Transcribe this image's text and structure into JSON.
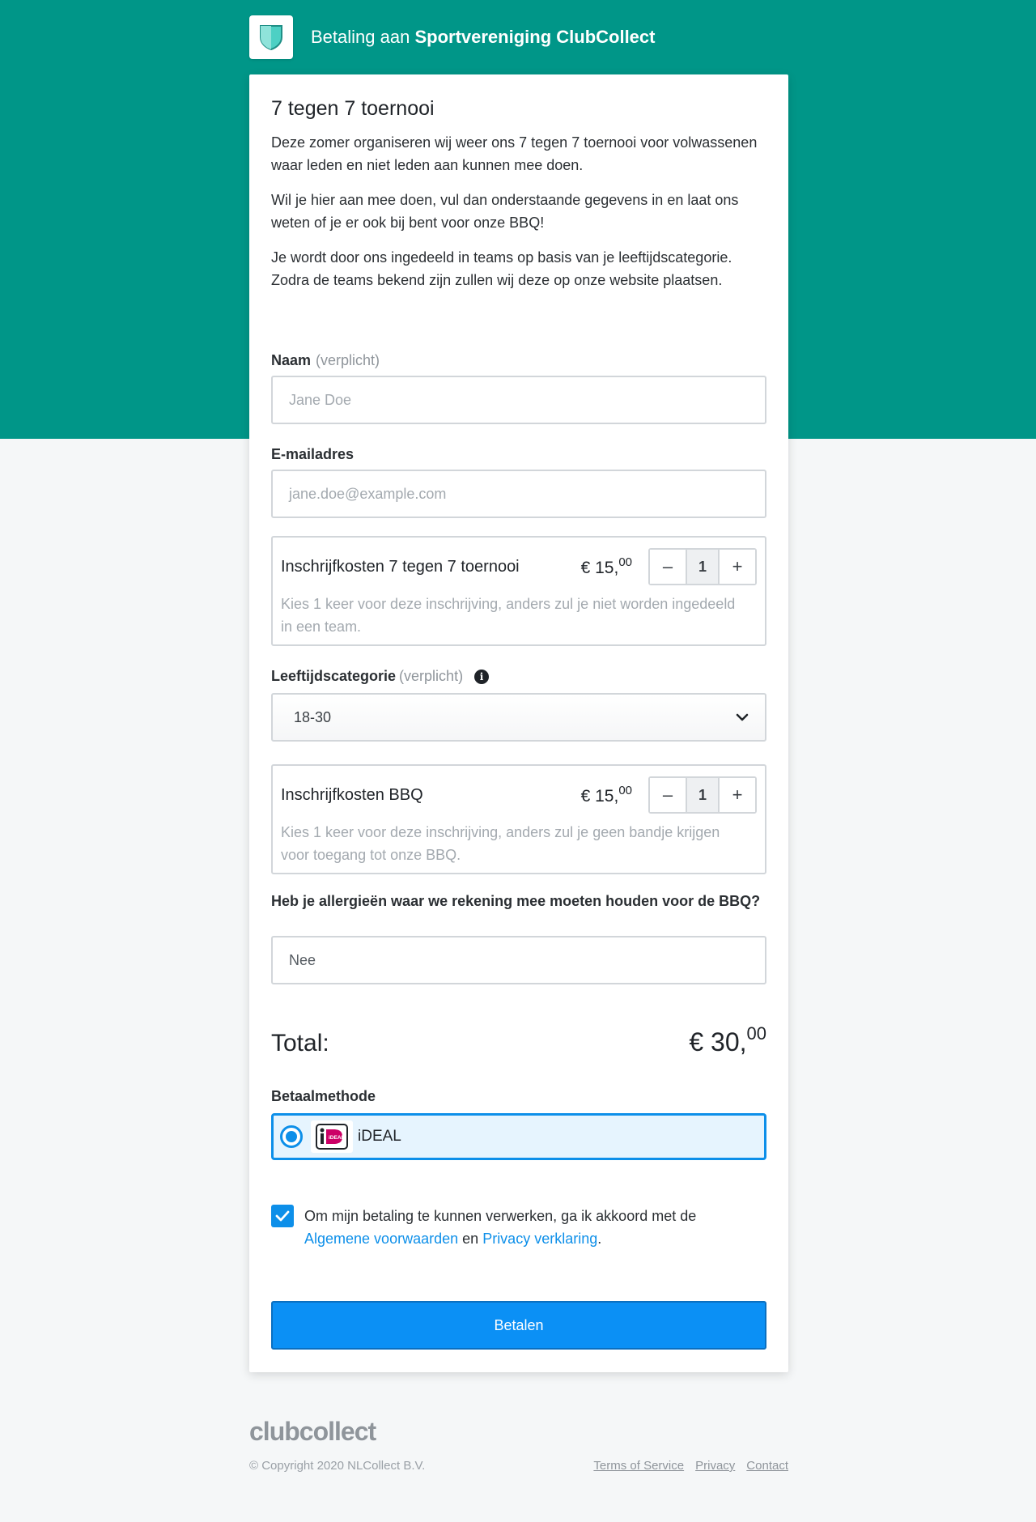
{
  "header": {
    "prefix": "Betaling aan",
    "club_name": "Sportvereniging ClubCollect"
  },
  "form": {
    "title": "7 tegen 7 toernooi",
    "description": [
      "Deze zomer organiseren wij weer ons 7 tegen 7 toernooi voor volwassenen waar leden en niet leden aan kunnen mee doen.",
      "Wil je hier aan mee doen, vul dan onderstaande gegevens in en laat ons weten of je er ook bij bent voor onze BBQ!",
      "Je wordt door ons ingedeeld in teams op basis van je leeftijdscategorie. Zodra de teams bekend zijn zullen wij deze op onze website plaatsen."
    ],
    "name_field": {
      "label": "Naam",
      "required_hint": "(verplicht)",
      "placeholder": "Jane Doe"
    },
    "email_field": {
      "label": "E-mailadres",
      "placeholder": "jane.doe@example.com"
    },
    "products": [
      {
        "name": "Inschrijfkosten 7 tegen 7 toernooi",
        "price_main": "€ 15,",
        "price_cents": "00",
        "quantity": "1",
        "minus": "–",
        "plus": "+",
        "description": "Kies 1 keer voor deze inschrijving, anders zul je niet worden ingedeeld in een team."
      },
      {
        "name": "Inschrijfkosten BBQ",
        "price_main": "€ 15,",
        "price_cents": "00",
        "quantity": "1",
        "minus": "–",
        "plus": "+",
        "description": "Kies 1 keer voor deze inschrijving, anders zul je geen bandje krijgen voor toegang tot onze BBQ."
      }
    ],
    "age_category": {
      "label": "Leeftijdscategorie",
      "required_hint": "(verplicht)",
      "info_icon": "i",
      "selected": "18-30"
    },
    "allergies": {
      "label": "Heb je allergieën waar we rekening mee moeten houden voor de BBQ?",
      "value": "Nee"
    },
    "total": {
      "label": "Total:",
      "value_main": "€ 30,",
      "value_cents": "00"
    },
    "payment": {
      "label": "Betaalmethode",
      "method": "iDEAL",
      "logo_text": "iDEAL",
      "selected": true
    },
    "consent": {
      "checked": true,
      "text_before": "Om mijn betaling te kunnen verwerken, ga ik akkoord met de",
      "terms_link": "Algemene voorwaarden",
      "and": "en",
      "privacy_link": "Privacy verklaring",
      "end": "."
    },
    "submit_label": "Betalen"
  },
  "footer": {
    "logo": "clubcollect",
    "copyright": "© Copyright 2020 NLCollect B.V.",
    "links": [
      "Terms of Service",
      "Privacy",
      "Contact"
    ]
  },
  "colors": {
    "header_bg": "#009688",
    "accent": "#0d8fe9",
    "button": "#0b90f5",
    "page_bg": "#f5f7f8"
  },
  "icons": {
    "club_logo": "shield-icon",
    "chevron": "chevron-down-icon",
    "info": "info-icon",
    "check": "check-icon"
  }
}
